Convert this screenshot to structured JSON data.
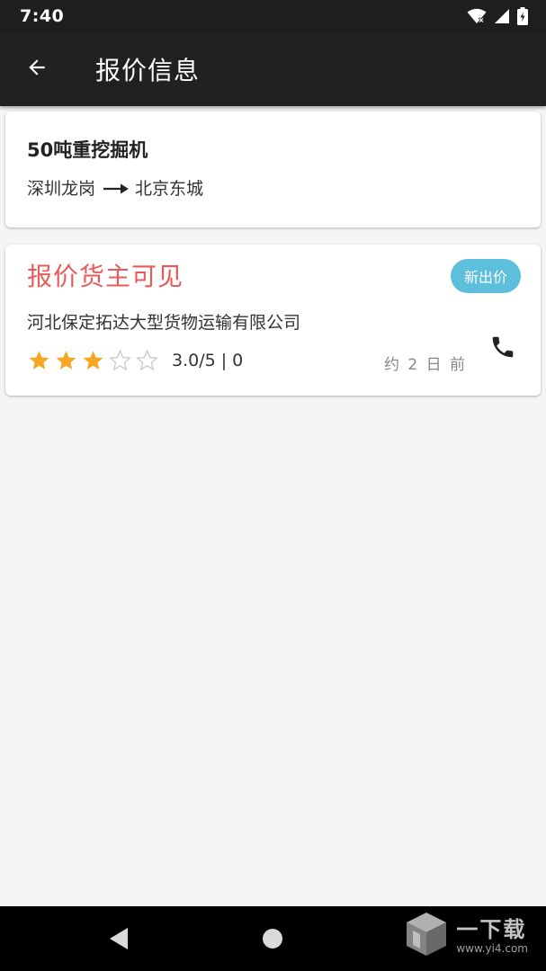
{
  "status_bar": {
    "time": "7:40"
  },
  "app_bar": {
    "title": "报价信息"
  },
  "cargo": {
    "name": "50吨重挖掘机",
    "from": "深圳龙岗",
    "to": "北京东城"
  },
  "quote": {
    "price_text": "报价货主可见",
    "badge": "新出价",
    "company": "河北保定拓达大型货物运输有限公司",
    "rating": 3.0,
    "rating_max": 5,
    "rating_text": "3.0/5 | 0",
    "time_ago": "约 2 日 前"
  },
  "watermark": {
    "title": "一下载",
    "url": "www.yi4.com"
  },
  "colors": {
    "status_bar": "#1e1e1e",
    "app_bar": "#212121",
    "background": "#f5f5f5",
    "price_red": "#e95a5a",
    "badge_blue": "#5ebfdc",
    "star_filled": "#f5a623",
    "star_empty": "#c8c8c8"
  },
  "icons": {
    "back": "arrow-left-icon",
    "phone": "phone-icon",
    "star": "star-icon",
    "wifi": "wifi-icon",
    "signal": "signal-icon",
    "battery": "battery-icon"
  }
}
